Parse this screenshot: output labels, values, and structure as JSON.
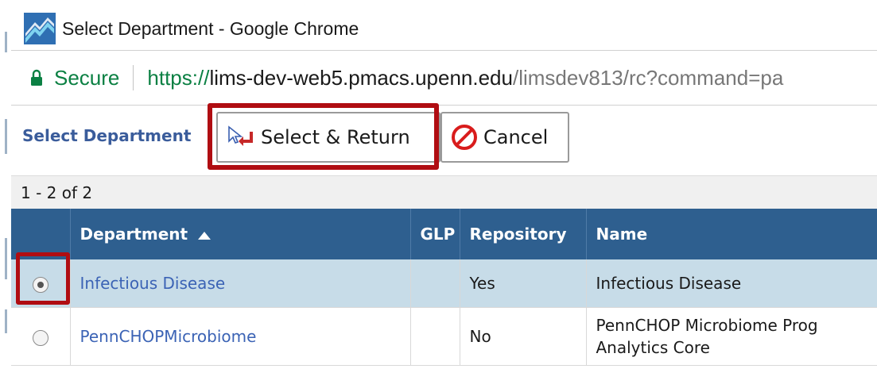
{
  "window": {
    "title": "Select Department - Google Chrome"
  },
  "address_bar": {
    "secure_label": "Secure",
    "url_scheme": "https://",
    "url_host": "lims-dev-web5.pmacs.upenn.edu",
    "url_path": "/limsdev813/rc?command=pa"
  },
  "toolbar": {
    "title": "Select Department",
    "select_return_label": "Select & Return",
    "cancel_label": "Cancel"
  },
  "pager": {
    "count_text": "1 - 2 of 2"
  },
  "table": {
    "columns": {
      "department": "Department",
      "glp": "GLP",
      "repository": "Repository",
      "name": "Name"
    },
    "rows": [
      {
        "department": "Infectious Disease",
        "glp": "",
        "repository": "Yes",
        "name": "Infectious Disease",
        "name_line2": "",
        "selected": true
      },
      {
        "department": "PennCHOPMicrobiome",
        "glp": "",
        "repository": "No",
        "name": "PennCHOP Microbiome Prog",
        "name_line2": "Analytics Core",
        "selected": false
      }
    ]
  },
  "colors": {
    "header_bg": "#2e5f8f",
    "selected_row_bg": "#c7dce8",
    "highlight": "#b00d12",
    "link": "#3b63b5",
    "secure_green": "#0b8043"
  },
  "icons": {
    "app": "app-logo-icon",
    "lock": "lock-icon",
    "select_return": "cursor-return-arrow-icon",
    "cancel": "no-entry-icon",
    "sort": "sort-ascending-icon"
  }
}
